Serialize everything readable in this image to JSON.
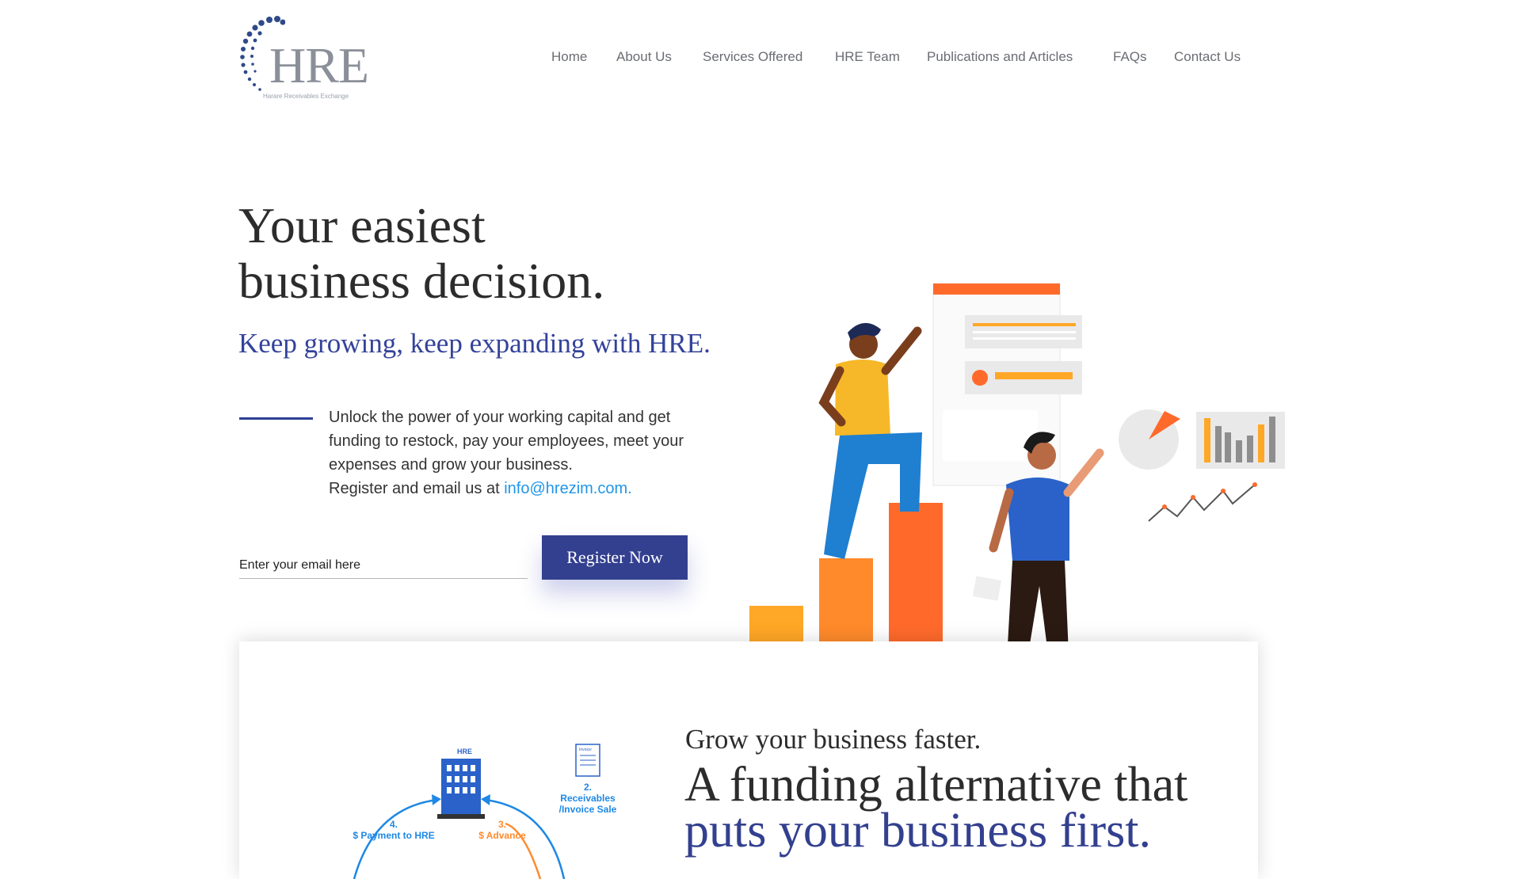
{
  "logo": {
    "text": "HRE",
    "subtitle": "Harare Receivables Exchange"
  },
  "nav": {
    "items": [
      {
        "label": "Home"
      },
      {
        "label": "About Us"
      },
      {
        "label": "Services Offered"
      },
      {
        "label": "HRE Team"
      },
      {
        "label": "Publications and Articles"
      },
      {
        "label": "FAQs"
      },
      {
        "label": "Contact Us"
      }
    ]
  },
  "hero": {
    "title_line1": "Your easiest",
    "title_line2": "business decision.",
    "tagline": "Keep growing, keep expanding with HRE.",
    "desc_line1": "Unlock the power of your working capital and get",
    "desc_line2": "funding to restock, pay your employees, meet your",
    "desc_line3": "expenses and grow your business.",
    "desc_line4_prefix": "Register and email us at ",
    "email_link": "info@hrezim.com.",
    "email_placeholder": "Enter your email here",
    "register_label": "Register Now"
  },
  "card": {
    "subtitle": "Grow your business faster.",
    "title_line1": "A funding alternative that",
    "title_line2": "puts your business first.",
    "diagram": {
      "building_label": "HRE",
      "invoice_label": "Invoice",
      "step2_num": "2.",
      "step2_line1": "Receivables",
      "step2_line2": "/Invoice Sale",
      "step3_num": "3.",
      "step3_label": "$ Advance",
      "step4_num": "4.",
      "step4_label": "$ Payment to HRE"
    }
  },
  "colors": {
    "brand_blue": "#33408f",
    "link_blue": "#2196e8",
    "orange": "#ff6a2b",
    "amber": "#ffa726"
  }
}
